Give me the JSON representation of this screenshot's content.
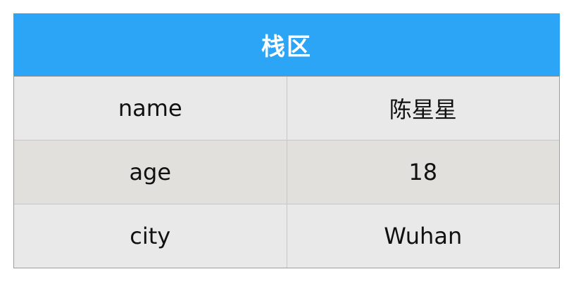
{
  "stack": {
    "title": "栈区",
    "rows": [
      {
        "key": "name",
        "value": "陈星星"
      },
      {
        "key": "age",
        "value": "18"
      },
      {
        "key": "city",
        "value": "Wuhan"
      }
    ]
  },
  "colors": {
    "header_background": "#2da5f7",
    "header_text": "#ffffff",
    "row_odd_background": "#e9e9e9",
    "row_even_background": "#e1e0dc",
    "border": "#9c9c9c"
  }
}
